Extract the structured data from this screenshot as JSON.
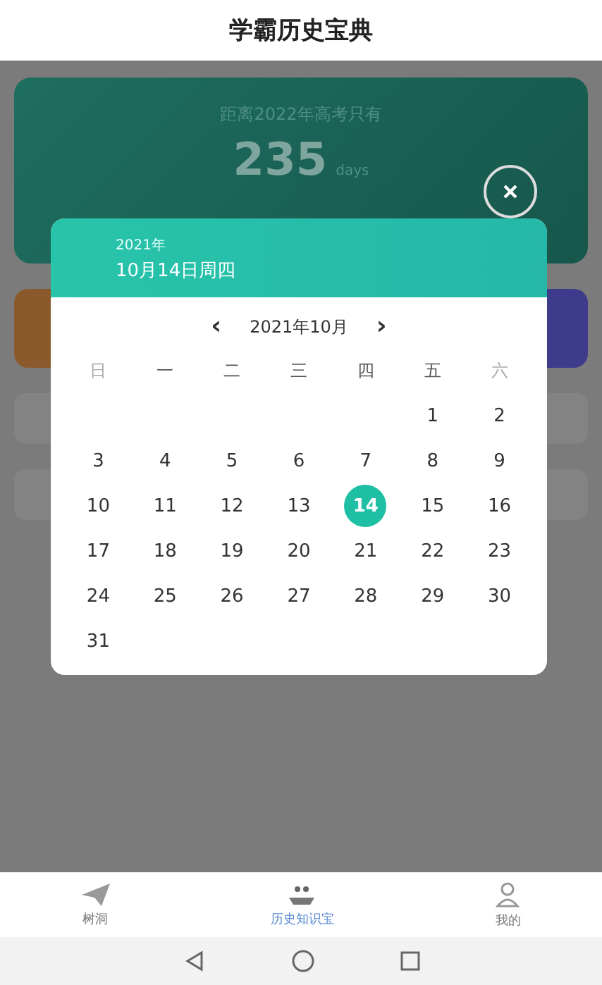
{
  "header": {
    "title": "学霸历史宝典"
  },
  "countdown": {
    "caption": "距离2022年高考只有",
    "number": "235",
    "unit": "days"
  },
  "calendar": {
    "year": "2021年",
    "date": "10月14日周四",
    "prev": "‹",
    "month": "2021年10月",
    "next": "›",
    "weekdays": [
      {
        "label": "日",
        "weekend": true
      },
      {
        "label": "一",
        "weekend": false
      },
      {
        "label": "二",
        "weekend": false
      },
      {
        "label": "三",
        "weekend": false
      },
      {
        "label": "四",
        "weekend": false
      },
      {
        "label": "五",
        "weekend": false
      },
      {
        "label": "六",
        "weekend": true
      }
    ],
    "weeks": [
      [
        {
          "kind": "blank"
        },
        {
          "kind": "blank"
        },
        {
          "kind": "blank"
        },
        {
          "kind": "blank"
        },
        {
          "kind": "blank"
        },
        {
          "kind": "day",
          "label": "1",
          "selected": false
        },
        {
          "kind": "day",
          "label": "2",
          "selected": false
        }
      ],
      [
        {
          "kind": "day",
          "label": "3",
          "selected": false
        },
        {
          "kind": "day",
          "label": "4",
          "selected": false
        },
        {
          "kind": "day",
          "label": "5",
          "selected": false
        },
        {
          "kind": "day",
          "label": "6",
          "selected": false
        },
        {
          "kind": "day",
          "label": "7",
          "selected": false
        },
        {
          "kind": "day",
          "label": "8",
          "selected": false
        },
        {
          "kind": "day",
          "label": "9",
          "selected": false
        }
      ],
      [
        {
          "kind": "day",
          "label": "10",
          "selected": false
        },
        {
          "kind": "day",
          "label": "11",
          "selected": false
        },
        {
          "kind": "day",
          "label": "12",
          "selected": false
        },
        {
          "kind": "day",
          "label": "13",
          "selected": false
        },
        {
          "kind": "day",
          "label": "14",
          "selected": true
        },
        {
          "kind": "day",
          "label": "15",
          "selected": false
        },
        {
          "kind": "day",
          "label": "16",
          "selected": false
        }
      ],
      [
        {
          "kind": "day",
          "label": "17",
          "selected": false
        },
        {
          "kind": "day",
          "label": "18",
          "selected": false
        },
        {
          "kind": "day",
          "label": "19",
          "selected": false
        },
        {
          "kind": "day",
          "label": "20",
          "selected": false
        },
        {
          "kind": "day",
          "label": "21",
          "selected": false
        },
        {
          "kind": "day",
          "label": "22",
          "selected": false
        },
        {
          "kind": "day",
          "label": "23",
          "selected": false
        }
      ],
      [
        {
          "kind": "day",
          "label": "24",
          "selected": false
        },
        {
          "kind": "day",
          "label": "25",
          "selected": false
        },
        {
          "kind": "day",
          "label": "26",
          "selected": false
        },
        {
          "kind": "day",
          "label": "27",
          "selected": false
        },
        {
          "kind": "day",
          "label": "28",
          "selected": false
        },
        {
          "kind": "day",
          "label": "29",
          "selected": false
        },
        {
          "kind": "day",
          "label": "30",
          "selected": false
        }
      ],
      [
        {
          "kind": "day",
          "label": "31",
          "selected": false
        },
        {
          "kind": "blank"
        },
        {
          "kind": "blank"
        },
        {
          "kind": "blank"
        },
        {
          "kind": "blank"
        },
        {
          "kind": "blank"
        },
        {
          "kind": "blank"
        }
      ]
    ]
  },
  "tabs": [
    {
      "label": "树洞",
      "kind": "plane",
      "selected": false
    },
    {
      "label": "历史知识宝",
      "kind": "boat",
      "selected": true
    },
    {
      "label": "我的",
      "kind": "person",
      "selected": false
    }
  ]
}
